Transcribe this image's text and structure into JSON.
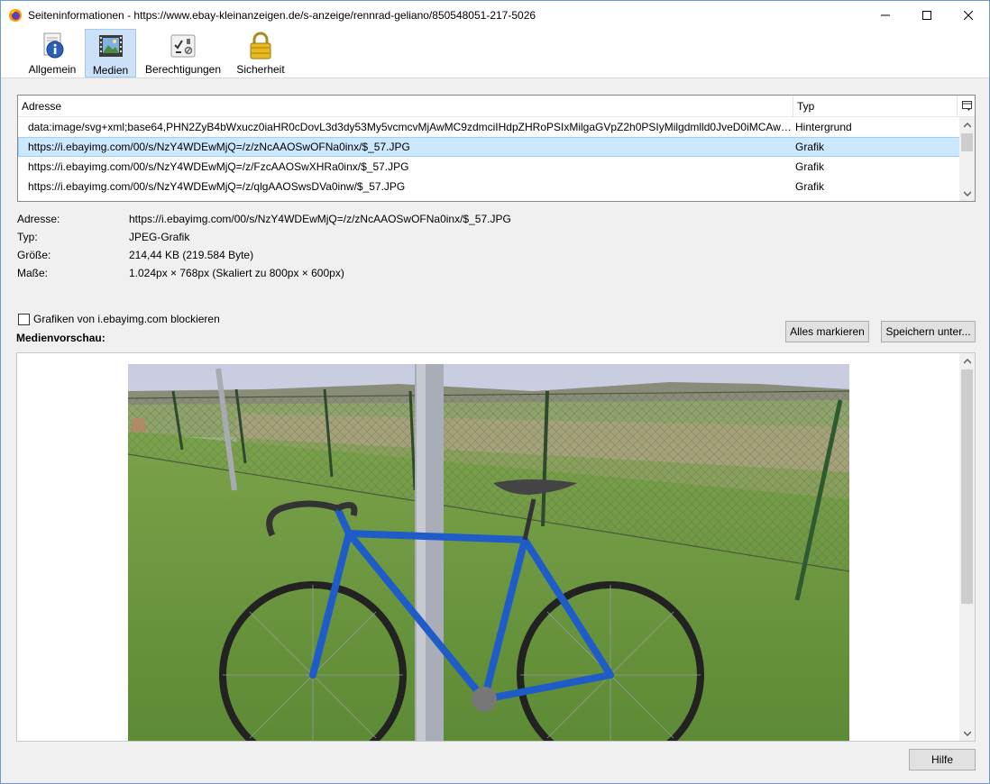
{
  "window": {
    "title": "Seiteninformationen - https://www.ebay-kleinanzeigen.de/s-anzeige/rennrad-geliano/850548051-217-5026"
  },
  "toolbar": {
    "tabs": [
      {
        "label": "Allgemein",
        "icon": "info-icon",
        "active": false
      },
      {
        "label": "Medien",
        "icon": "media-icon",
        "active": true
      },
      {
        "label": "Berechtigungen",
        "icon": "permissions-icon",
        "active": false
      },
      {
        "label": "Sicherheit",
        "icon": "lock-icon",
        "active": false
      }
    ]
  },
  "media_list": {
    "columns": [
      "Adresse",
      "Typ"
    ],
    "rows": [
      {
        "address": "data:image/svg+xml;base64,PHN2ZyB4bWxucz0iaHR0cDovL3d3dy53My5vcmcvMjAwMC9zdmciIHdpZHRoPSIxMilgaGVpZ2h0PSIyMilgdmlld0JveD0iMCAwIDE…",
        "type": "Hintergrund",
        "selected": false
      },
      {
        "address": "https://i.ebayimg.com/00/s/NzY4WDEwMjQ=/z/zNcAAOSwOFNa0inx/$_57.JPG",
        "type": "Grafik",
        "selected": true
      },
      {
        "address": "https://i.ebayimg.com/00/s/NzY4WDEwMjQ=/z/FzcAAOSwXHRa0inx/$_57.JPG",
        "type": "Grafik",
        "selected": false
      },
      {
        "address": "https://i.ebayimg.com/00/s/NzY4WDEwMjQ=/z/qlgAAOSwsDVa0inw/$_57.JPG",
        "type": "Grafik",
        "selected": false
      }
    ]
  },
  "details": {
    "address_label": "Adresse:",
    "address_value": "https://i.ebayimg.com/00/s/NzY4WDEwMjQ=/z/zNcAAOSwOFNa0inx/$_57.JPG",
    "type_label": "Typ:",
    "type_value": "JPEG-Grafik",
    "size_label": "Größe:",
    "size_value": "214,44 KB (219.584 Byte)",
    "dims_label": "Maße:",
    "dims_value": "1.024px × 768px (Skaliert zu 800px × 600px)"
  },
  "block_checkbox": {
    "label": "Grafiken von i.ebayimg.com blockieren",
    "checked": false
  },
  "preview_label": "Medienvorschau:",
  "buttons": {
    "select_all": "Alles markieren",
    "save_as": "Speichern unter...",
    "help": "Hilfe"
  },
  "colors": {
    "selection": "#cce8ff",
    "active_tab": "#cce0f7",
    "window_border": "#6e9ad6"
  }
}
